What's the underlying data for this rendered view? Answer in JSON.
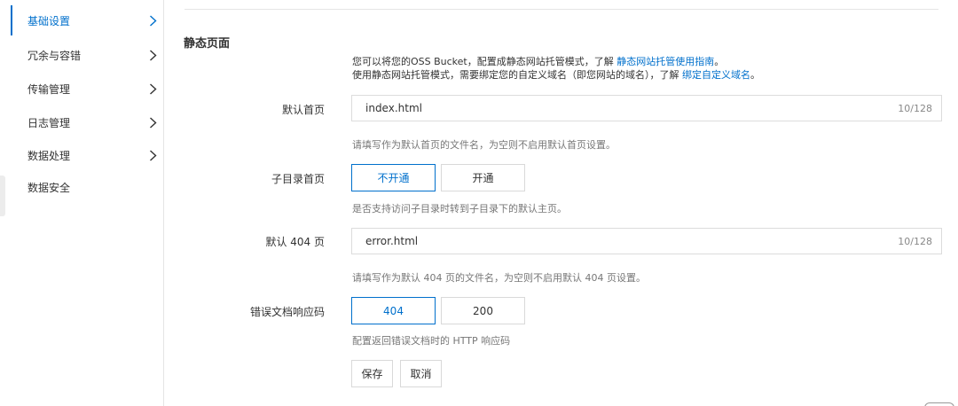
{
  "sidebar": {
    "items": [
      {
        "label": "基础设置",
        "active": true,
        "has_chevron": true
      },
      {
        "label": "冗余与容错",
        "active": false,
        "has_chevron": true
      },
      {
        "label": "传输管理",
        "active": false,
        "has_chevron": true
      },
      {
        "label": "日志管理",
        "active": false,
        "has_chevron": true
      },
      {
        "label": "数据处理",
        "active": false,
        "has_chevron": true
      },
      {
        "label": "数据安全",
        "active": false,
        "has_chevron": false
      }
    ]
  },
  "section": {
    "title": "静态页面",
    "intro_line1_text": "您可以将您的OSS Bucket，配置成静态网站托管模式，了解 ",
    "intro_line1_link": "静态网站托管使用指南",
    "intro_line1_end": "。",
    "intro_line2_text": "使用静态网站托管模式，需要绑定您的自定义域名（即您网站的域名），了解 ",
    "intro_line2_link": "绑定自定义域名",
    "intro_line2_end": "。"
  },
  "form": {
    "index_page": {
      "label": "默认首页",
      "value": "index.html",
      "counter": "10/128",
      "hint": "请填写作为默认首页的文件名，为空则不启用默认首页设置。"
    },
    "subdir_index": {
      "label": "子目录首页",
      "options": [
        "不开通",
        "开通"
      ],
      "selected": "不开通",
      "hint": "是否支持访问子目录时转到子目录下的默认主页。"
    },
    "error_page": {
      "label": "默认 404 页",
      "value": "error.html",
      "counter": "10/128",
      "hint": "请填写作为默认 404 页的文件名，为空则不启用默认 404 页设置。"
    },
    "error_code": {
      "label": "错误文档响应码",
      "options": [
        "404",
        "200"
      ],
      "selected": "404",
      "hint": "配置返回错误文档时的 HTTP 响应码"
    },
    "save_label": "保存",
    "cancel_label": "取消"
  },
  "colors": {
    "accent": "#0070cc",
    "border": "#dcdcdc",
    "hint_text": "#777777"
  },
  "icons": {
    "nav_chevron": "chevron-right-icon"
  }
}
